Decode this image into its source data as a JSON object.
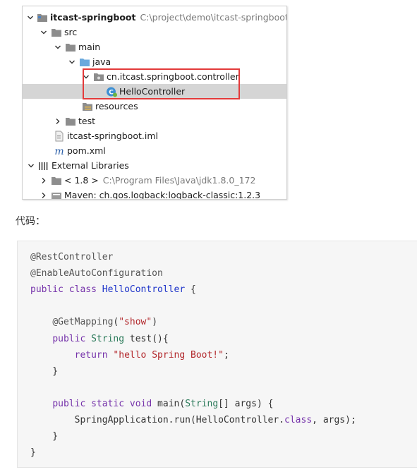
{
  "tree": {
    "rows": [
      {
        "label": "itcast-springboot",
        "path": "C:\\project\\demo\\itcast-springboot",
        "chevron": "down",
        "icon": "module-folder-icon"
      },
      {
        "label": "src",
        "chevron": "down",
        "icon": "folder-icon"
      },
      {
        "label": "main",
        "chevron": "down",
        "icon": "folder-icon"
      },
      {
        "label": "java",
        "chevron": "down",
        "icon": "source-folder-icon"
      },
      {
        "label": "cn.itcast.springboot.controller",
        "chevron": "down",
        "icon": "package-icon"
      },
      {
        "label": "HelloController",
        "chevron": "none",
        "icon": "spring-class-icon",
        "selected": true
      },
      {
        "label": "resources",
        "chevron": "none",
        "icon": "resources-folder-icon"
      },
      {
        "label": "test",
        "chevron": "right",
        "icon": "folder-icon"
      },
      {
        "label": "itcast-springboot.iml",
        "chevron": "none",
        "icon": "iml-file-icon"
      },
      {
        "label": "pom.xml",
        "chevron": "none",
        "icon": "maven-icon"
      },
      {
        "label": "External Libraries",
        "chevron": "down",
        "icon": "libraries-icon"
      },
      {
        "label": "< 1.8 >",
        "path": "C:\\Program Files\\Java\\jdk1.8.0_172",
        "chevron": "right",
        "icon": "jdk-icon"
      },
      {
        "label": "Maven: ch.qos.logback:logback-classic:1.2.3",
        "chevron": "right",
        "icon": "library-icon"
      }
    ]
  },
  "caption": "代码：",
  "code": {
    "lines": [
      [
        [
          "anno",
          "@RestController"
        ]
      ],
      [
        [
          "anno",
          "@EnableAutoConfiguration"
        ]
      ],
      [
        [
          "kw",
          "public"
        ],
        [
          "plain",
          " "
        ],
        [
          "kw",
          "class"
        ],
        [
          "plain",
          " "
        ],
        [
          "cls",
          "HelloController"
        ],
        [
          "plain",
          " {"
        ]
      ],
      [],
      [
        [
          "plain",
          "    "
        ],
        [
          "anno",
          "@GetMapping"
        ],
        [
          "plain",
          "("
        ],
        [
          "str",
          "\"show\""
        ],
        [
          "plain",
          ")"
        ]
      ],
      [
        [
          "plain",
          "    "
        ],
        [
          "kw",
          "public"
        ],
        [
          "plain",
          " "
        ],
        [
          "type",
          "String"
        ],
        [
          "plain",
          " test(){"
        ]
      ],
      [
        [
          "plain",
          "        "
        ],
        [
          "kw",
          "return"
        ],
        [
          "plain",
          " "
        ],
        [
          "str",
          "\"hello Spring Boot!\""
        ],
        [
          "plain",
          ";"
        ]
      ],
      [
        [
          "plain",
          "    }"
        ]
      ],
      [],
      [
        [
          "plain",
          "    "
        ],
        [
          "kw",
          "public"
        ],
        [
          "plain",
          " "
        ],
        [
          "kw",
          "static"
        ],
        [
          "plain",
          " "
        ],
        [
          "kw",
          "void"
        ],
        [
          "plain",
          " main("
        ],
        [
          "type",
          "String"
        ],
        [
          "plain",
          "[] args) {"
        ]
      ],
      [
        [
          "plain",
          "        SpringApplication.run(HelloController."
        ],
        [
          "kw",
          "class"
        ],
        [
          "plain",
          ", args);"
        ]
      ],
      [
        [
          "plain",
          "    }"
        ]
      ],
      [
        [
          "plain",
          "}"
        ]
      ]
    ]
  }
}
